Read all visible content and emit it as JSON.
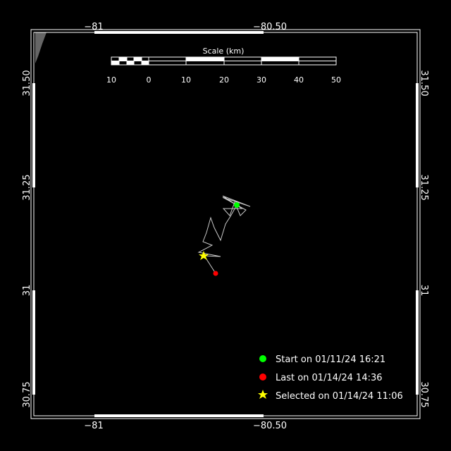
{
  "map": {
    "lon_ticks": [
      "−81",
      "−80.50"
    ],
    "lat_ticks": [
      "31.50",
      "31.25",
      "31",
      "30.75"
    ],
    "scale": {
      "title": "Scale (km)",
      "labels": [
        "10",
        "0",
        "10",
        "20",
        "30",
        "40",
        "50"
      ]
    },
    "legend": {
      "start": "Start on 01/11/24 16:21",
      "last": "Last on 01/14/24 14:36",
      "selected": "Selected on 01/14/24 11:06"
    },
    "colors": {
      "start": "#00ff00",
      "last": "#ff0000",
      "selected": "#ffff00",
      "track": "#c8c8c8",
      "land": "#666666",
      "frame": "#ffffff"
    }
  }
}
